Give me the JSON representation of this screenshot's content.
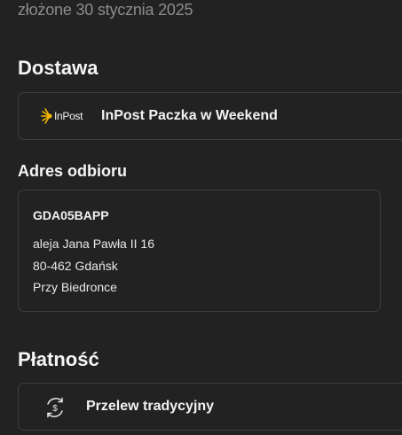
{
  "order": {
    "date_text": "złożone 30 stycznia 2025"
  },
  "delivery": {
    "heading": "Dostawa",
    "carrier_logo_text": "InPost",
    "method_label": "InPost Paczka w Weekend"
  },
  "pickup": {
    "heading": "Adres odbioru",
    "point_code": "GDA05BAPP",
    "street": "aleja Jana Pawła II 16",
    "city": "80-462 Gdańsk",
    "note": "Przy Biedronce"
  },
  "payment": {
    "heading": "Płatność",
    "method_label": "Przelew tradycyjny"
  },
  "colors": {
    "inpost_yellow": "#f5b800",
    "background": "#222222",
    "border": "#3e3e3e"
  }
}
